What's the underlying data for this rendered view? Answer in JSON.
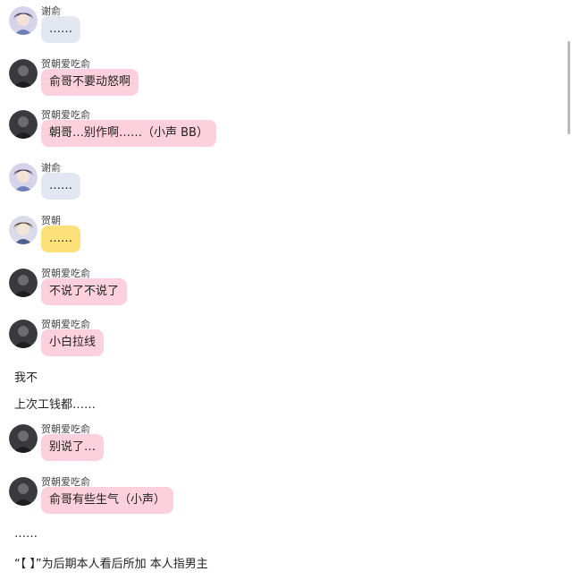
{
  "senders": {
    "xieyu": "谢俞",
    "hezhao_fan": "贺朝爱吃俞",
    "hezhao": "贺朝"
  },
  "messages": [
    {
      "sender": "谢俞",
      "text": "……",
      "avatar": "xieyu-avatar-icon",
      "bubble_color": "#e2e7f2"
    },
    {
      "sender": "贺朝爱吃俞",
      "text": "俞哥不要动怒啊",
      "avatar": "hezhao-fan-avatar-icon",
      "bubble_color": "#fcd0dc"
    },
    {
      "sender": "贺朝爱吃俞",
      "text": "朝哥…别作啊……（小声 BB）",
      "avatar": "hezhao-fan-avatar-icon",
      "bubble_color": "#fcd0dc"
    },
    {
      "sender": "谢俞",
      "text": "……",
      "avatar": "xieyu-avatar-icon",
      "bubble_color": "#e2e7f2"
    },
    {
      "sender": "贺朝",
      "text": "……",
      "avatar": "hezhao-avatar-icon",
      "bubble_color": "#fce07a"
    },
    {
      "sender": "贺朝爱吃俞",
      "text": "不说了不说了",
      "avatar": "hezhao-fan-avatar-icon",
      "bubble_color": "#fcd0dc"
    },
    {
      "sender": "贺朝爱吃俞",
      "text": "小白拉线",
      "avatar": "hezhao-fan-avatar-icon",
      "bubble_color": "#fcd0dc"
    },
    {
      "sender": "贺朝爱吃俞",
      "text": "别说了…",
      "avatar": "hezhao-fan-avatar-icon",
      "bubble_color": "#fcd0dc"
    },
    {
      "sender": "贺朝爱吃俞",
      "text": "俞哥有些生气（小声）",
      "avatar": "hezhao-fan-avatar-icon",
      "bubble_color": "#fcd0dc"
    }
  ],
  "narration": {
    "line1": "我不",
    "line2": "上次工钱都……",
    "line3": "……",
    "footnote": "“【 】”为后期本人看后所加 本人指男主"
  }
}
